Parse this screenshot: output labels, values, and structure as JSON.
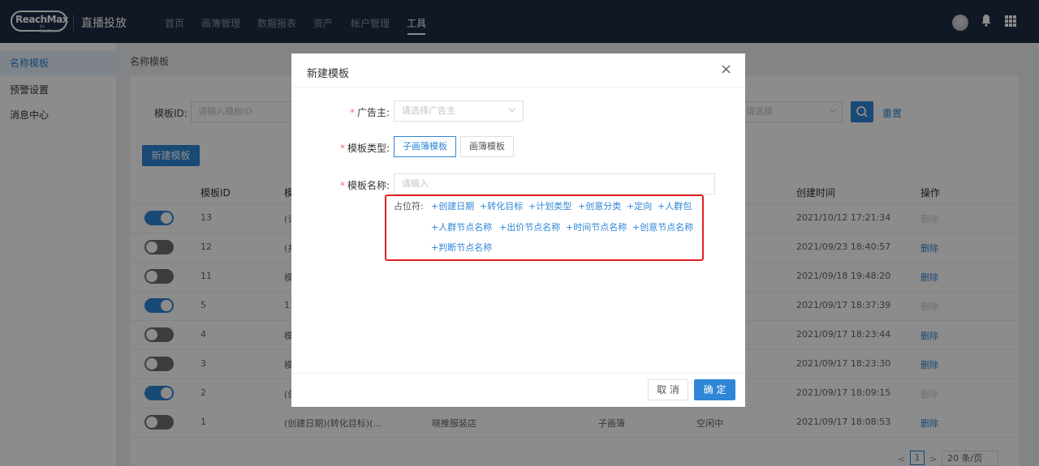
{
  "nav": {
    "logo_text": "ReachMax",
    "logo_sub": "by AddNewer",
    "brand": "直播投放",
    "items": [
      "首页",
      "画簿管理",
      "数据报表",
      "资产",
      "帐户管理",
      "工具"
    ],
    "active_index": 5
  },
  "sidebar": {
    "items": [
      "名称模板",
      "预警设置",
      "消息中心"
    ],
    "active_index": 0
  },
  "page": {
    "breadcrumb": "名称模板",
    "filter_label": "模板ID:",
    "filter_placeholder": "请输入模板ID",
    "select_placeholder": "请选择",
    "reset_label": "重置",
    "new_button": "新建模板"
  },
  "table": {
    "headers": [
      "模板ID",
      "模",
      "创建时间",
      "操作"
    ],
    "rows": [
      {
        "on": true,
        "id": "13",
        "name": "(计",
        "created": "2021/10/12 17:21:34",
        "action": "删除",
        "disabled": true
      },
      {
        "on": false,
        "id": "12",
        "name": "(并",
        "created": "2021/09/23 18:40:57",
        "action": "删除",
        "disabled": false
      },
      {
        "on": false,
        "id": "11",
        "name": "模",
        "created": "2021/09/18 19:48:20",
        "action": "删除",
        "disabled": false
      },
      {
        "on": true,
        "id": "5",
        "name": "11",
        "created": "2021/09/17 18:37:39",
        "action": "删除",
        "disabled": true
      },
      {
        "on": false,
        "id": "4",
        "name": "模",
        "created": "2021/09/17 18:23:44",
        "action": "删除",
        "disabled": false
      },
      {
        "on": false,
        "id": "3",
        "name": "模",
        "created": "2021/09/17 18:23:30",
        "action": "删除",
        "disabled": false
      },
      {
        "on": true,
        "id": "2",
        "name": "(创",
        "created": "2021/09/17 18:09:15",
        "action": "删除",
        "disabled": true
      },
      {
        "on": false,
        "id": "1",
        "name": "(创建日期)(转化目标)(...",
        "advertiser": "晓推服装店",
        "type": "子画簿",
        "status": "空闲中",
        "created": "2021/09/17 18:08:53",
        "action": "删除",
        "disabled": false
      }
    ]
  },
  "pager": {
    "prev": "<",
    "page": "1",
    "next": ">",
    "page_size": "20 条/页"
  },
  "modal": {
    "title": "新建模板",
    "close": "×",
    "advertiser_label": "广告主:",
    "advertiser_placeholder": "请选择广告主",
    "type_label": "模板类型:",
    "type_options": [
      "子画簿模板",
      "画簿模板"
    ],
    "type_active": 0,
    "name_label": "模板名称:",
    "name_placeholder": "请输入",
    "placeholder_label": "占位符:",
    "chips": [
      "+创建日期",
      "+转化目标",
      "+计划类型",
      "+创意分类",
      "+定向",
      "+人群包",
      "+人群节点名称",
      "+出价节点名称",
      "+时间节点名称",
      "+创意节点名称",
      "+判断节点名称"
    ],
    "cancel": "取 消",
    "ok": "确 定"
  },
  "colors": {
    "nav_bg": "#1e2c44",
    "accent": "#2f86d6",
    "highlight": "#e02020"
  }
}
